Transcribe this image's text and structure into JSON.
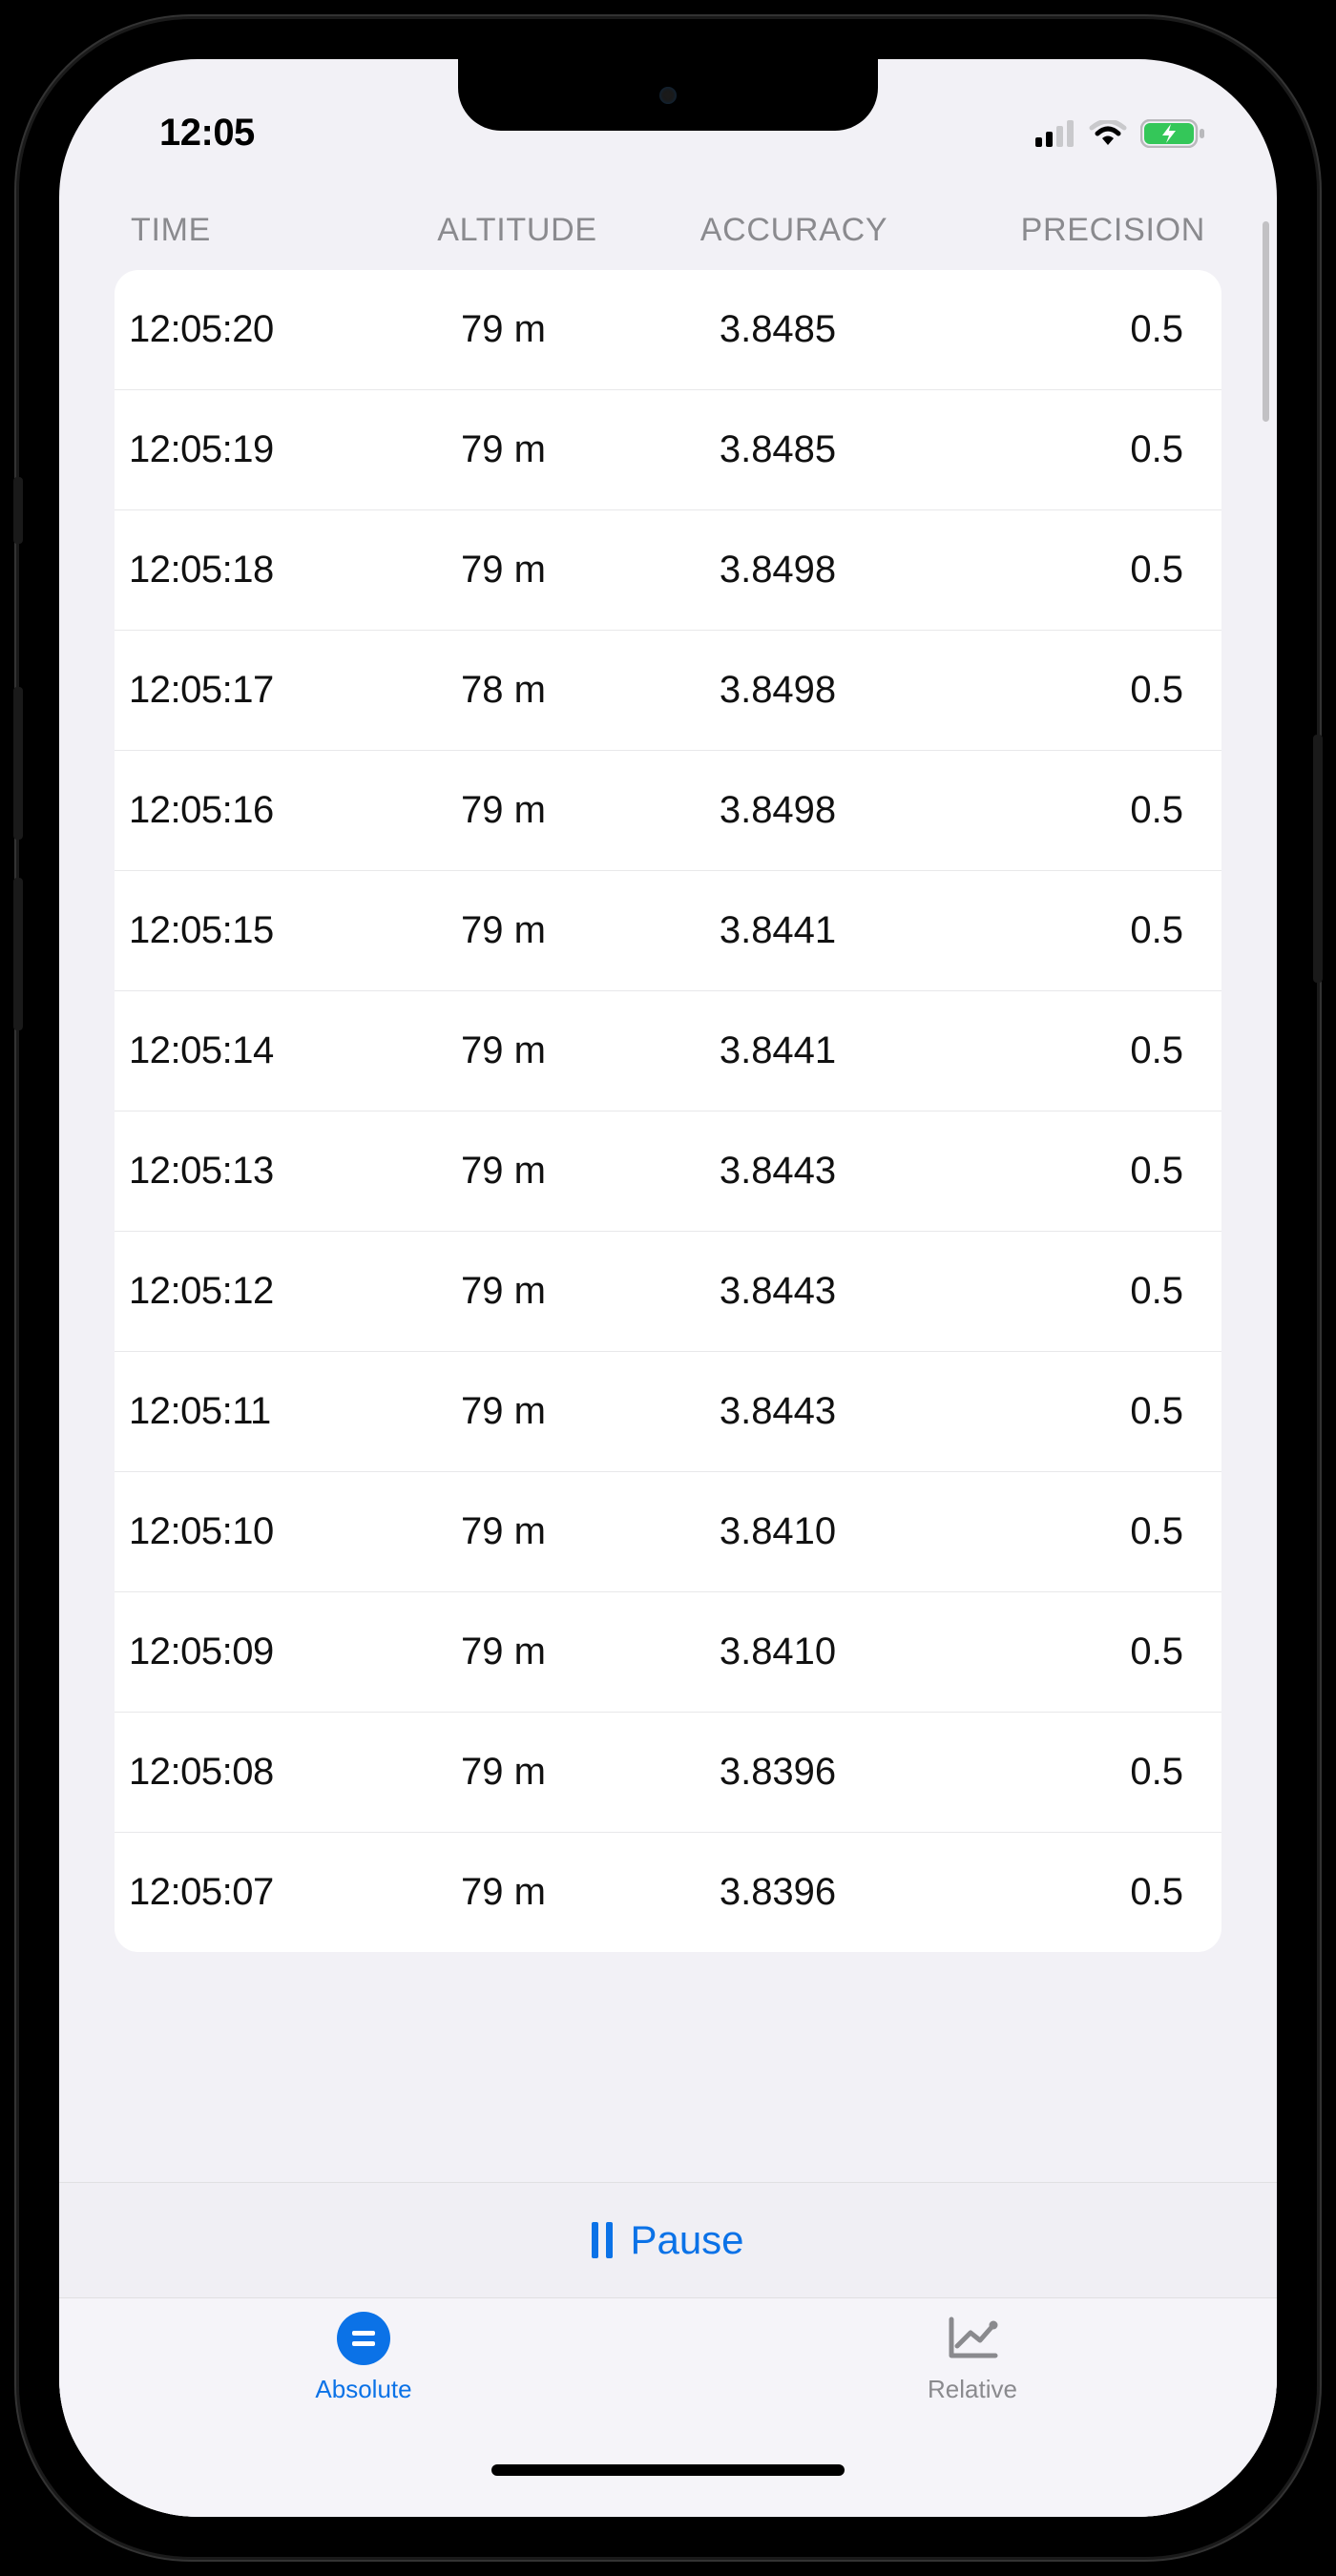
{
  "status": {
    "time": "12:05"
  },
  "table": {
    "headers": {
      "time": "TIME",
      "altitude": "ALTITUDE",
      "accuracy": "ACCURACY",
      "precision": "PRECISION"
    },
    "rows": [
      {
        "time": "12:05:20",
        "altitude": "79 m",
        "accuracy": "3.8485",
        "precision": "0.5"
      },
      {
        "time": "12:05:19",
        "altitude": "79 m",
        "accuracy": "3.8485",
        "precision": "0.5"
      },
      {
        "time": "12:05:18",
        "altitude": "79 m",
        "accuracy": "3.8498",
        "precision": "0.5"
      },
      {
        "time": "12:05:17",
        "altitude": "78 m",
        "accuracy": "3.8498",
        "precision": "0.5"
      },
      {
        "time": "12:05:16",
        "altitude": "79 m",
        "accuracy": "3.8498",
        "precision": "0.5"
      },
      {
        "time": "12:05:15",
        "altitude": "79 m",
        "accuracy": "3.8441",
        "precision": "0.5"
      },
      {
        "time": "12:05:14",
        "altitude": "79 m",
        "accuracy": "3.8441",
        "precision": "0.5"
      },
      {
        "time": "12:05:13",
        "altitude": "79 m",
        "accuracy": "3.8443",
        "precision": "0.5"
      },
      {
        "time": "12:05:12",
        "altitude": "79 m",
        "accuracy": "3.8443",
        "precision": "0.5"
      },
      {
        "time": "12:05:11",
        "altitude": "79 m",
        "accuracy": "3.8443",
        "precision": "0.5"
      },
      {
        "time": "12:05:10",
        "altitude": "79 m",
        "accuracy": "3.8410",
        "precision": "0.5"
      },
      {
        "time": "12:05:09",
        "altitude": "79 m",
        "accuracy": "3.8410",
        "precision": "0.5"
      },
      {
        "time": "12:05:08",
        "altitude": "79 m",
        "accuracy": "3.8396",
        "precision": "0.5"
      },
      {
        "time": "12:05:07",
        "altitude": "79 m",
        "accuracy": "3.8396",
        "precision": "0.5"
      }
    ]
  },
  "controls": {
    "pause_label": "Pause"
  },
  "tabs": {
    "absolute": "Absolute",
    "relative": "Relative"
  },
  "colors": {
    "accent": "#0b72e7",
    "mutedText": "#8a8a8e",
    "screenBg": "#f2f1f6"
  }
}
